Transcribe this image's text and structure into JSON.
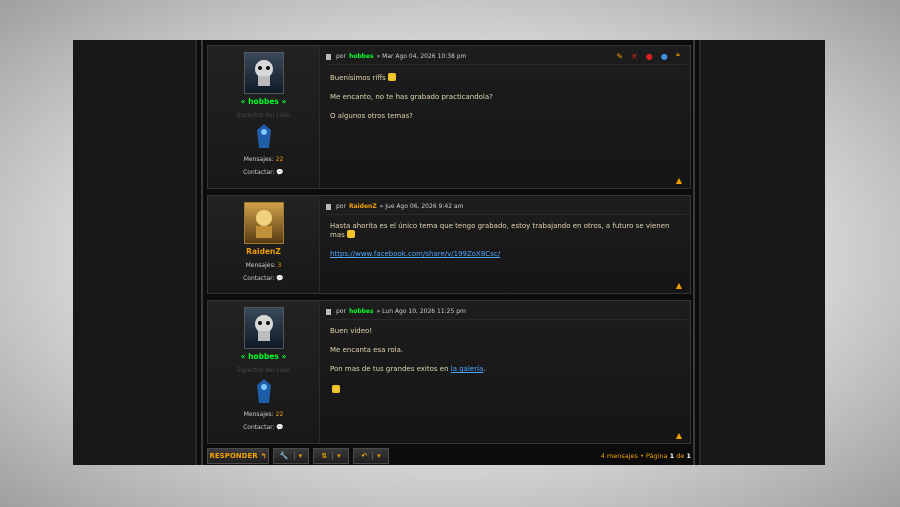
{
  "posts": [
    {
      "username": "« hobbes »",
      "rank": "Espectro del cielo",
      "messages_label": "Mensajes:",
      "messages_count": "22",
      "contact_label": "Contactar:",
      "header_prefix": "por",
      "author": "hobbes",
      "date": "» Mar Ago 04, 2026 10:38 pm",
      "lines": [
        "Buenísimos riffs",
        "Me encanto, no te has grabado practicandola?",
        "O algunos otros temas?"
      ]
    },
    {
      "username": "RaidenZ",
      "messages_label": "Mensajes:",
      "messages_count": "3",
      "contact_label": "Contactar:",
      "header_prefix": "por",
      "author": "RaidenZ",
      "date": "» Jue Ago 06, 2026 9:42 am",
      "lines": [
        "Hasta ahorita es el único tema que tengo grabado, estoy trabajando en otros, a futuro se vienen mas"
      ],
      "link": "https://www.facebook.com/share/v/199ZoX8Csc/"
    },
    {
      "username": "« hobbes »",
      "rank": "Espectro del cielo",
      "messages_label": "Mensajes:",
      "messages_count": "22",
      "contact_label": "Contactar:",
      "header_prefix": "por",
      "author": "hobbes",
      "date": "» Lun Ago 10, 2026 11:25 pm",
      "lines": [
        "Buen video!",
        "Me encanta esa rola.",
        "Pon mas de tus grandes exitos en"
      ],
      "link_text": "la galería",
      "link_suffix": "."
    }
  ],
  "toolbar": {
    "reply_label": "RESPONDER"
  },
  "pagination": {
    "messages": "4 mensajes •",
    "page_label": "Página",
    "current": "1",
    "of_label": "de",
    "total": "1"
  }
}
